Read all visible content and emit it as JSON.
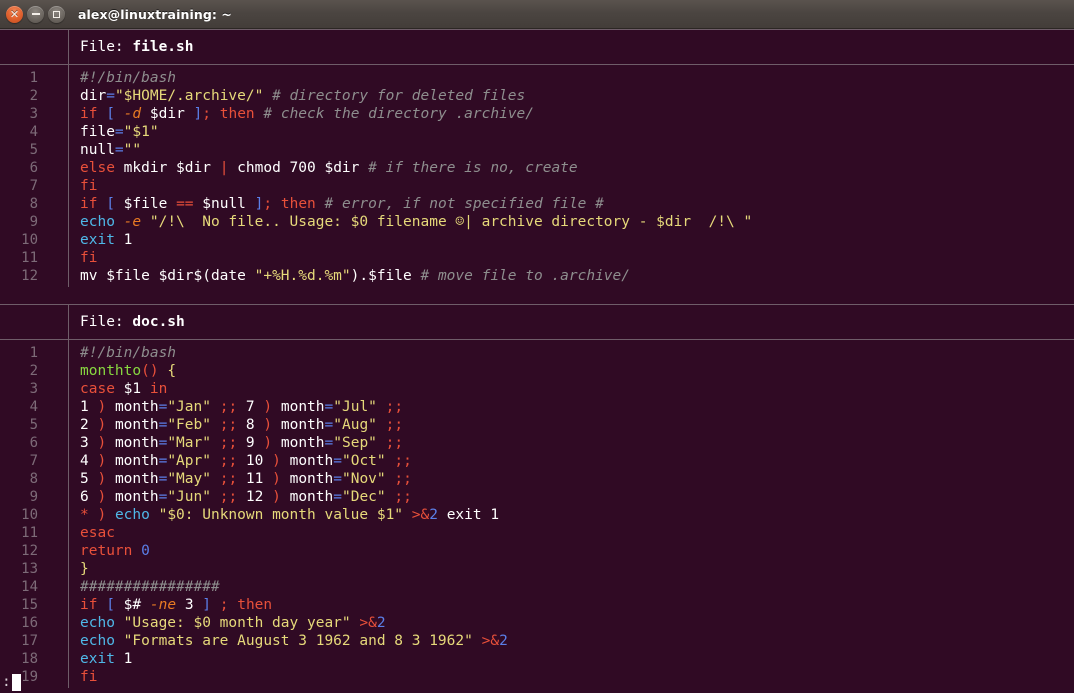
{
  "window": {
    "title": "alex@linuxtraining: ~",
    "buttons": {
      "close": "close-button",
      "minimize": "minimize-button",
      "maximize": "maximize-button"
    },
    "background_color": "#300a24",
    "titlebar_color": "#4b4541"
  },
  "pager": {
    "prompt": ":",
    "cursor": "block-cursor"
  },
  "files": [
    {
      "header_label": "File: ",
      "header_name": "file.sh",
      "lines": [
        {
          "n": "1",
          "text": "#!/bin/bash"
        },
        {
          "n": "2",
          "text": "dir=\"$HOME/.archive/\" # directory for deleted files"
        },
        {
          "n": "3",
          "text": "if [ -d $dir ]; then # check the directory .archive/"
        },
        {
          "n": "4",
          "text": "file=\"$1\""
        },
        {
          "n": "5",
          "text": "null=\"\""
        },
        {
          "n": "6",
          "text": "else mkdir $dir | chmod 700 $dir # if there is no, create"
        },
        {
          "n": "7",
          "text": "fi"
        },
        {
          "n": "8",
          "text": "if [ $file == $null ]; then # error, if not specified file #"
        },
        {
          "n": "9",
          "text": "echo -e \"/!\\  No file.. Usage: $0 filename ☺| archive directory - $dir  /!\\ \""
        },
        {
          "n": "10",
          "text": "exit 1"
        },
        {
          "n": "11",
          "text": "fi"
        },
        {
          "n": "12",
          "text": "mv $file $dir$(date \"+%H.%d.%m\").$file # move file to .archive/"
        }
      ]
    },
    {
      "header_label": "File: ",
      "header_name": "doc.sh",
      "lines": [
        {
          "n": "1",
          "text": "#!/bin/bash"
        },
        {
          "n": "2",
          "text": "monthto() {"
        },
        {
          "n": "3",
          "text": "case $1 in"
        },
        {
          "n": "4",
          "text": "1 ) month=\"Jan\" ;; 7 ) month=\"Jul\" ;;"
        },
        {
          "n": "5",
          "text": "2 ) month=\"Feb\" ;; 8 ) month=\"Aug\" ;;"
        },
        {
          "n": "6",
          "text": "3 ) month=\"Mar\" ;; 9 ) month=\"Sep\" ;;"
        },
        {
          "n": "7",
          "text": "4 ) month=\"Apr\" ;; 10 ) month=\"Oct\" ;;"
        },
        {
          "n": "8",
          "text": "5 ) month=\"May\" ;; 11 ) month=\"Nov\" ;;"
        },
        {
          "n": "9",
          "text": "6 ) month=\"Jun\" ;; 12 ) month=\"Dec\" ;;"
        },
        {
          "n": "10",
          "text": "* ) echo \"$0: Unknown month value $1\" >&2 exit 1"
        },
        {
          "n": "11",
          "text": "esac"
        },
        {
          "n": "12",
          "text": "return 0"
        },
        {
          "n": "13",
          "text": "}"
        },
        {
          "n": "14",
          "text": "################"
        },
        {
          "n": "15",
          "text": "if [ $# -ne 3 ] ; then"
        },
        {
          "n": "16",
          "text": "echo \"Usage: $0 month day year\" >&2"
        },
        {
          "n": "17",
          "text": "echo \"Formats are August 3 1962 and 8 3 1962\" >&2"
        },
        {
          "n": "18",
          "text": "exit 1"
        },
        {
          "n": "19",
          "text": "fi"
        }
      ]
    }
  ],
  "syntax_colors": {
    "comment": "#8e8e8e",
    "keyword": "#e8503a",
    "string": "#e6d97a",
    "builtin": "#4fb8e8",
    "function": "#88d840",
    "flag": "#e87a23",
    "bracket": "#5b7fe8",
    "plain": "#ffffff",
    "linenumber": "#7d6b78"
  }
}
